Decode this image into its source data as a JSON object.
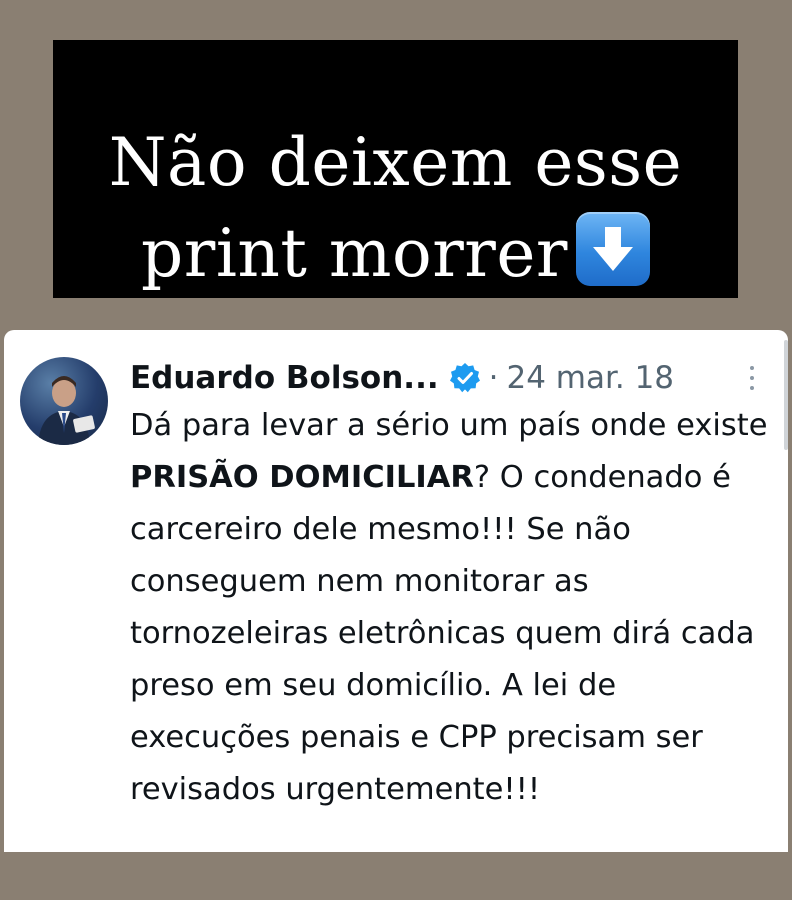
{
  "headline": {
    "line1": "Não deixem esse",
    "line2": "print morrer",
    "emoji": "down-arrow-icon"
  },
  "tweet": {
    "author": "Eduardo Bolson...",
    "separator": "·",
    "date": "24 mar. 18",
    "text_before_bold": "Dá para levar a sério um país onde existe ",
    "text_bold": "PRISÃO DOMICILIAR",
    "text_after_bold": "? O condenado é carcereiro dele mesmo!!! Se não conseguem nem monitorar as tornozeleiras eletrônicas quem dirá cada preso em seu domicílio. A lei de execuções penais e CPP precisam ser revisados urgentemente!!!"
  },
  "colors": {
    "page_background": "#8a7f72",
    "headline_background": "#000000",
    "headline_text": "#ffffff",
    "verified_blue": "#1d9bf0",
    "tweet_text": "#0f1419",
    "muted_text": "#536471"
  }
}
